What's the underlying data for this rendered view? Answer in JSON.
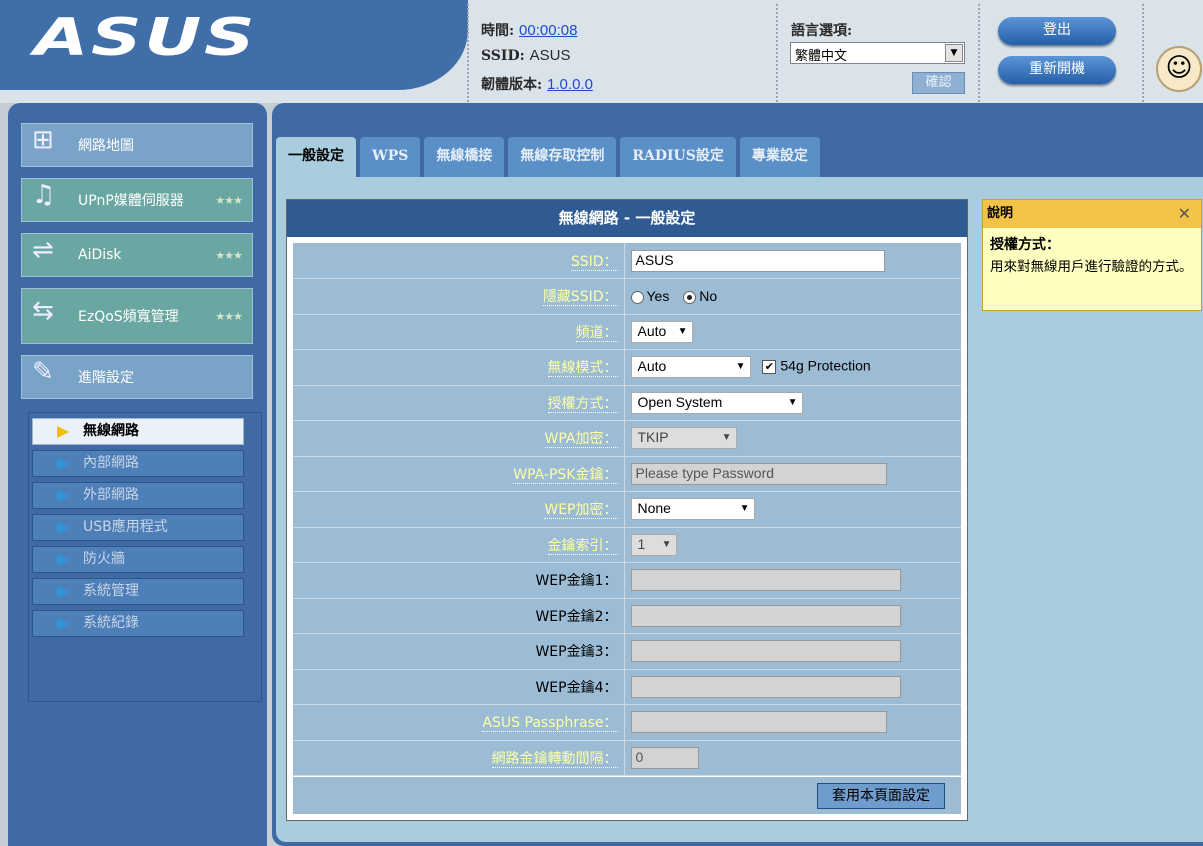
{
  "header": {
    "logo": "/ISUS",
    "time_label": "時間:",
    "time_value": "00:00:08",
    "ssid_label": "SSID:",
    "ssid_value": "ASUS",
    "firmware_label": "韌體版本:",
    "firmware_value": "1.0.0.0",
    "lang_label": "語言選項:",
    "lang_value": "繁體中文",
    "lang_confirm": "確認",
    "logout": "登出",
    "reboot": "重新開機"
  },
  "sidebar": {
    "items": [
      {
        "label": "網路地圖",
        "icon": "network-map-icon"
      },
      {
        "label": "UPnP媒體伺服器",
        "icon": "media-server-icon"
      },
      {
        "label": "AiDisk",
        "icon": "aidisk-icon"
      },
      {
        "label": "EzQoS頻寬管理",
        "icon": "ezqos-icon"
      },
      {
        "label": "進階設定",
        "icon": "tools-icon"
      }
    ],
    "submenu": [
      "無線網路",
      "內部網路",
      "外部網路",
      "USB應用程式",
      "防火牆",
      "系統管理",
      "系統紀錄"
    ]
  },
  "tabs": [
    "一般設定",
    "WPS",
    "無線橋接",
    "無線存取控制",
    "RADIUS設定",
    "專業設定"
  ],
  "panel": {
    "title": "無線網路 - 一般設定",
    "labels": {
      "ssid": "SSID：",
      "hide_ssid": "隱藏SSID：",
      "channel": "頻道：",
      "mode": "無線模式：",
      "auth": "授權方式：",
      "wpa_enc": "WPA加密：",
      "wpa_psk": "WPA-PSK金鑰：",
      "wep_enc": "WEP加密：",
      "key_index": "金鑰索引：",
      "wep1": "WEP金鑰1：",
      "wep2": "WEP金鑰2：",
      "wep3": "WEP金鑰3：",
      "wep4": "WEP金鑰4：",
      "passphrase": "ASUS Passphrase：",
      "rotation": "網路金鑰轉動間隔："
    },
    "values": {
      "ssid": "ASUS",
      "hide_yes": "Yes",
      "hide_no": "No",
      "channel": "Auto",
      "mode": "Auto",
      "protection": "54g Protection",
      "auth": "Open System",
      "wpa_enc": "TKIP",
      "wpa_psk_placeholder": "Please type Password",
      "wep_enc": "None",
      "key_index": "1",
      "rotation": "0"
    },
    "apply": "套用本頁面設定"
  },
  "help": {
    "title": "說明",
    "heading": "授權方式：",
    "text": "用來對無線用戶進行驗證的方式。"
  }
}
